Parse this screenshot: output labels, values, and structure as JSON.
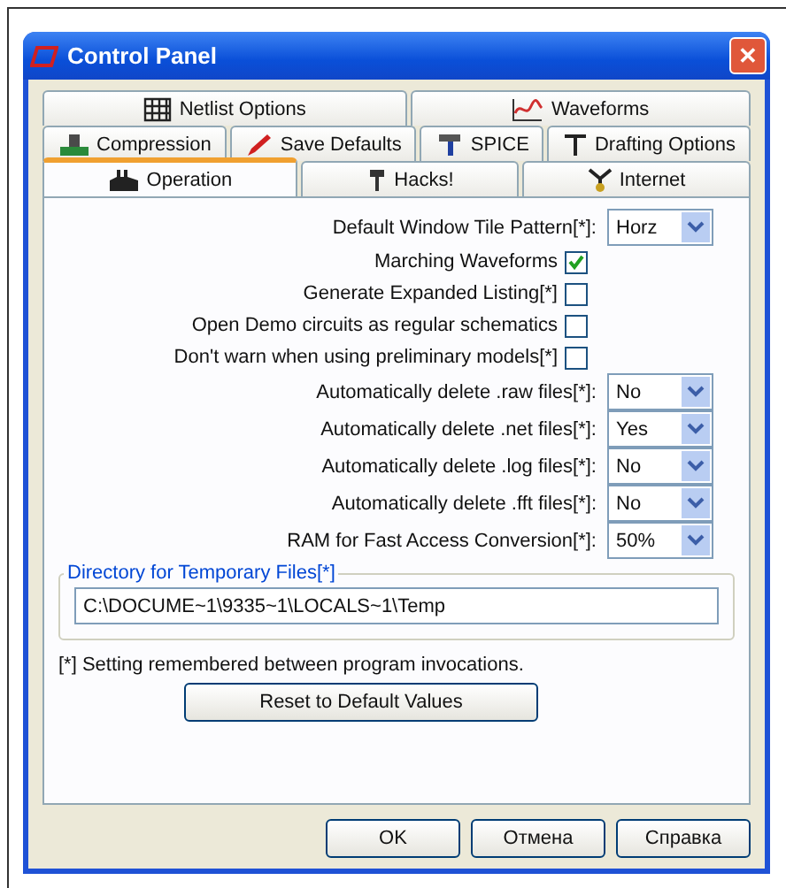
{
  "window": {
    "title": "Control Panel",
    "close": "✕"
  },
  "tab_rows": [
    [
      {
        "label": "Netlist Options",
        "selected": false
      },
      {
        "label": "Waveforms",
        "selected": false
      }
    ],
    [
      {
        "label": "Compression",
        "selected": false
      },
      {
        "label": "Save Defaults",
        "selected": false
      },
      {
        "label": "SPICE",
        "selected": false
      },
      {
        "label": "Drafting Options",
        "selected": false
      }
    ],
    [
      {
        "label": "Operation",
        "selected": true
      },
      {
        "label": "Hacks!",
        "selected": false
      },
      {
        "label": "Internet",
        "selected": false
      }
    ]
  ],
  "settings": [
    {
      "kind": "select",
      "label": "Default Window Tile Pattern[*]:",
      "value": "Horz"
    },
    {
      "kind": "checkbox",
      "label": "Marching Waveforms",
      "checked": true
    },
    {
      "kind": "checkbox",
      "label": "Generate Expanded Listing[*]",
      "checked": false
    },
    {
      "kind": "checkbox",
      "label": "Open Demo circuits as regular schematics",
      "checked": false
    },
    {
      "kind": "checkbox",
      "label": "Don't warn when using preliminary models[*]",
      "checked": false
    },
    {
      "kind": "select",
      "label": "Automatically delete .raw files[*]:",
      "value": "No"
    },
    {
      "kind": "select",
      "label": "Automatically delete .net files[*]:",
      "value": "Yes"
    },
    {
      "kind": "select",
      "label": "Automatically delete .log files[*]:",
      "value": "No"
    },
    {
      "kind": "select",
      "label": "Automatically delete .fft files[*]:",
      "value": "No"
    },
    {
      "kind": "select",
      "label": "RAM for Fast Access Conversion[*]:",
      "value": "50%"
    }
  ],
  "temp_directory": {
    "legend": "Directory for Temporary Files[*]",
    "value": "C:\\DOCUME~1\\9335~1\\LOCALS~1\\Temp"
  },
  "note": "[*] Setting remembered between program invocations.",
  "reset_button": "Reset to Default Values",
  "buttons": [
    "OK",
    "Отмена",
    "Справка"
  ]
}
